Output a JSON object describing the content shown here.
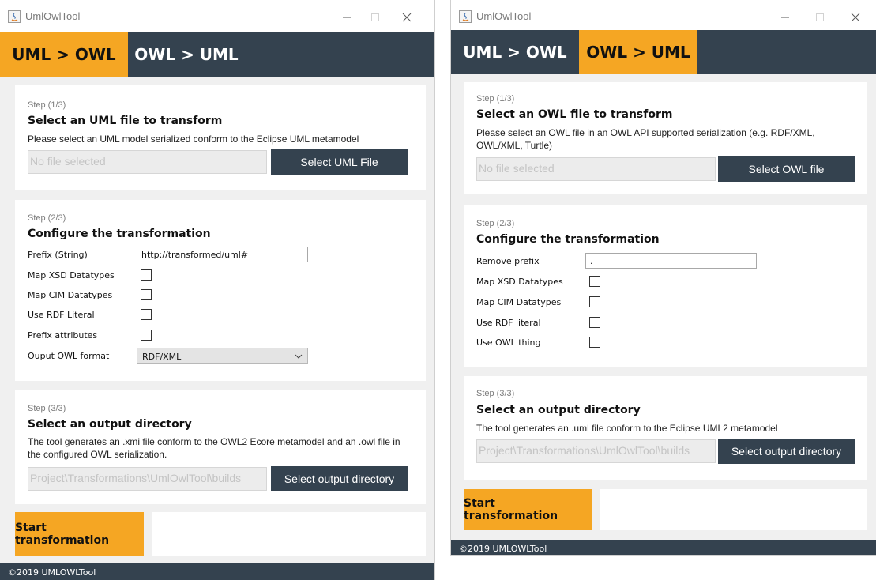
{
  "colors": {
    "accent": "#f5a623",
    "dark": "#34424f",
    "panel": "#ffffff",
    "background": "#f0f0f0"
  },
  "left": {
    "window_title": "UmlOwlTool",
    "tabs": [
      {
        "label": "UML > OWL",
        "active": true
      },
      {
        "label": "OWL > UML",
        "active": false
      }
    ],
    "step1": {
      "step": "Step (1/3)",
      "heading": "Select an UML file to transform",
      "description": "Please select an UML model serialized conform to the Eclipse UML metamodel",
      "file_value": "No file selected",
      "button": "Select UML File"
    },
    "step2": {
      "step": "Step (2/3)",
      "heading": "Configure the transformation",
      "prefix_label": "Prefix (String)",
      "prefix_value": "http://transformed/uml#",
      "options": [
        {
          "label": "Map XSD Datatypes",
          "checked": false
        },
        {
          "label": "Map CIM Datatypes",
          "checked": false
        },
        {
          "label": "Use RDF Literal",
          "checked": false
        },
        {
          "label": "Prefix attributes",
          "checked": false
        }
      ],
      "format_label": "Ouput OWL format",
      "format_value": "RDF/XML"
    },
    "step3": {
      "step": "Step (3/3)",
      "heading": "Select an output directory",
      "description": "The tool generates an .xmi file conform to the OWL2 Ecore metamodel and an .owl file in the configured OWL serialization.",
      "path_value": "Project\\Transformations\\UmlOwlTool\\builds",
      "button": "Select output directory"
    },
    "start_button": "Start transformation",
    "footer": "©2019 UMLOWLTool"
  },
  "right": {
    "window_title": "UmlOwlTool",
    "tabs": [
      {
        "label": "UML > OWL",
        "active": false
      },
      {
        "label": "OWL > UML",
        "active": true
      }
    ],
    "step1": {
      "step": "Step (1/3)",
      "heading": "Select an OWL file to transform",
      "description": "Please select an OWL file in an OWL API supported serialization (e.g. RDF/XML, OWL/XML, Turtle)",
      "file_value": "No file selected",
      "button": "Select OWL file"
    },
    "step2": {
      "step": "Step (2/3)",
      "heading": "Configure the transformation",
      "prefix_label": "Remove prefix",
      "prefix_value": ".",
      "options": [
        {
          "label": "Map XSD Datatypes",
          "checked": false
        },
        {
          "label": "Map CIM Datatypes",
          "checked": false
        },
        {
          "label": "Use RDF literal",
          "checked": false
        },
        {
          "label": "Use OWL thing",
          "checked": false
        }
      ]
    },
    "step3": {
      "step": "Step (3/3)",
      "heading": "Select an output directory",
      "description": "The tool generates an .uml file conform to the Eclipse UML2 metamodel",
      "path_value": "Project\\Transformations\\UmlOwlTool\\builds",
      "button": "Select output directory"
    },
    "start_button": "Start transformation",
    "footer": "©2019 UMLOWLTool"
  }
}
